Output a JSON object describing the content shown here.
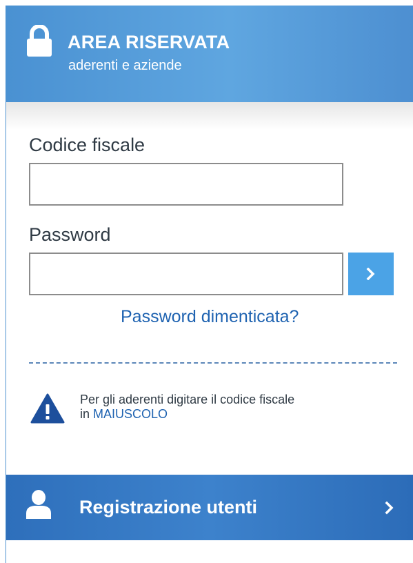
{
  "header": {
    "title": "AREA RISERVATA",
    "subtitle": "aderenti e aziende",
    "icon": "lock-icon"
  },
  "form": {
    "codice_fiscale": {
      "label": "Codice fiscale",
      "value": "",
      "placeholder": ""
    },
    "password": {
      "label": "Password",
      "value": "",
      "placeholder": ""
    },
    "submit_icon": "chevron-right-icon",
    "forgot_link": "Password dimenticata?"
  },
  "notice": {
    "icon": "warning-icon",
    "line1": "Per gli aderenti digitare il codice fiscale",
    "line2_prefix": "in ",
    "line2_emphasis": "MAIUSCOLO"
  },
  "register": {
    "icon": "user-icon",
    "label": "Registrazione utenti",
    "chevron": "chevron-right-icon"
  },
  "colors": {
    "header_blue": "#4a91d2",
    "button_blue": "#4ba3e6",
    "link_blue": "#1f63b1",
    "register_blue": "#2e6fbb",
    "warning_icon": "#1d4f9c",
    "text": "#2f3a44"
  }
}
